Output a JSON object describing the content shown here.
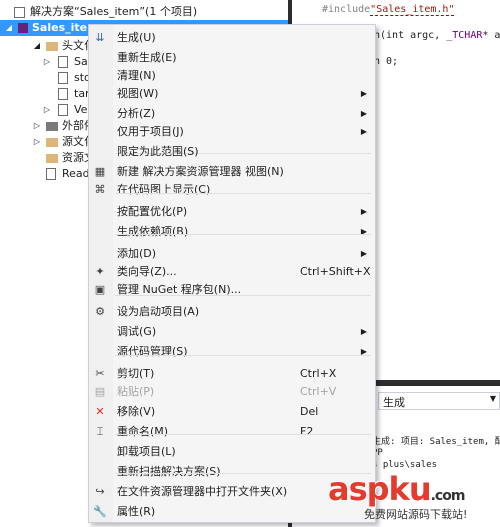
{
  "solution_explorer": {
    "rows": [
      {
        "label": "解决方案“Sales_item”(1 个项目)",
        "arrow": ""
      },
      {
        "label": "Sales_ite",
        "arrow": "◢"
      },
      {
        "label": "头文化",
        "arrow": "◢"
      },
      {
        "label": "Sa",
        "arrow": "▷"
      },
      {
        "label": "sto",
        "arrow": ""
      },
      {
        "label": "tar",
        "arrow": ""
      },
      {
        "label": "Ve",
        "arrow": "▷"
      },
      {
        "label": "外部依",
        "arrow": "▷"
      },
      {
        "label": "源文化",
        "arrow": "▷"
      },
      {
        "label": "资源文",
        "arrow": ""
      },
      {
        "label": "Read",
        "arrow": ""
      }
    ]
  },
  "code_editor": {
    "lines": [
      {
        "parts": [
          "#include",
          "\"Sales_item.h\""
        ]
      },
      {
        "parts": [
          "n(int argc, ",
          "_TCHAR",
          "* ar"
        ]
      },
      {
        "parts": [
          "n 0;"
        ]
      }
    ]
  },
  "output_pane": {
    "source_select": "生成",
    "lines": [
      "生成:  项目: Sales_item, 配",
      "PP",
      "s plus\\sales"
    ]
  },
  "context_menu": {
    "items": [
      {
        "label": "生成(U)",
        "shortcut": "",
        "submenu": false,
        "icon": "build-icon",
        "glyph": "⇊",
        "color": "#3a6ea5"
      },
      {
        "label": "重新生成(E)",
        "shortcut": "",
        "submenu": false,
        "icon": "",
        "glyph": "",
        "color": ""
      },
      {
        "label": "清理(N)",
        "shortcut": "",
        "submenu": false,
        "icon": "",
        "glyph": "",
        "color": ""
      },
      {
        "label": "视图(W)",
        "shortcut": "",
        "submenu": true,
        "icon": "",
        "glyph": "",
        "color": ""
      },
      {
        "label": "分析(Z)",
        "shortcut": "",
        "submenu": true,
        "icon": "",
        "glyph": "",
        "color": ""
      },
      {
        "label": "仅用于项目(J)",
        "shortcut": "",
        "submenu": true,
        "icon": "",
        "glyph": "",
        "color": ""
      },
      {
        "label": "限定为此范围(S)",
        "shortcut": "",
        "submenu": false,
        "icon": "",
        "glyph": "",
        "color": ""
      },
      {
        "label": "新建 解决方案资源管理器 视图(N)",
        "shortcut": "",
        "submenu": false,
        "icon": "new-view-icon",
        "glyph": "▦",
        "color": "#424242"
      },
      {
        "label": "在代码图上显示(C)",
        "shortcut": "",
        "submenu": false,
        "icon": "code-map-icon",
        "glyph": "⌘",
        "color": "#424242"
      },
      {
        "label": "按配置优化(P)",
        "shortcut": "",
        "submenu": true,
        "icon": "",
        "glyph": "",
        "color": ""
      },
      {
        "label": "生成依赖项(B)",
        "shortcut": "",
        "submenu": true,
        "icon": "",
        "glyph": "",
        "color": ""
      },
      {
        "label": "添加(D)",
        "shortcut": "",
        "submenu": true,
        "icon": "",
        "glyph": "",
        "color": ""
      },
      {
        "label": "类向导(Z)...",
        "shortcut": "Ctrl+Shift+X",
        "submenu": false,
        "icon": "class-wizard-icon",
        "glyph": "✦",
        "color": "#424242"
      },
      {
        "label": "管理 NuGet 程序包(N)...",
        "shortcut": "",
        "submenu": false,
        "icon": "nuget-icon",
        "glyph": "▣",
        "color": "#424242"
      },
      {
        "label": "设为启动项目(A)",
        "shortcut": "",
        "submenu": false,
        "icon": "gear-icon",
        "glyph": "⚙",
        "color": "#424242"
      },
      {
        "label": "调试(G)",
        "shortcut": "",
        "submenu": true,
        "icon": "",
        "glyph": "",
        "color": ""
      },
      {
        "label": "源代码管理(S)",
        "shortcut": "",
        "submenu": true,
        "icon": "",
        "glyph": "",
        "color": ""
      },
      {
        "label": "剪切(T)",
        "shortcut": "Ctrl+X",
        "submenu": false,
        "icon": "scissors-icon",
        "glyph": "✂",
        "color": "#424242"
      },
      {
        "label": "粘贴(P)",
        "shortcut": "Ctrl+V",
        "submenu": false,
        "icon": "paste-icon",
        "glyph": "▤",
        "color": "#a2a4a5",
        "disabled": true
      },
      {
        "label": "移除(V)",
        "shortcut": "Del",
        "submenu": false,
        "icon": "delete-icon",
        "glyph": "✕",
        "color": "#d32f2f"
      },
      {
        "label": "重命名(M)",
        "shortcut": "F2",
        "submenu": false,
        "icon": "rename-icon",
        "glyph": "⌶",
        "color": "#424242"
      },
      {
        "label": "卸载项目(L)",
        "shortcut": "",
        "submenu": false,
        "icon": "",
        "glyph": "",
        "color": ""
      },
      {
        "label": "重新扫描解决方案(S)",
        "shortcut": "",
        "submenu": false,
        "icon": "",
        "glyph": "",
        "color": ""
      },
      {
        "label": "在文件资源管理器中打开文件夹(X)",
        "shortcut": "",
        "submenu": false,
        "icon": "open-folder-icon",
        "glyph": "↪",
        "color": "#424242"
      },
      {
        "label": "属性(R)",
        "shortcut": "",
        "submenu": false,
        "icon": "wrench-icon",
        "glyph": "🔧",
        "color": "#424242"
      }
    ]
  },
  "watermark": {
    "main": "aspku",
    "dot_com": ".com",
    "sub": "免费网站源码下载站!"
  }
}
